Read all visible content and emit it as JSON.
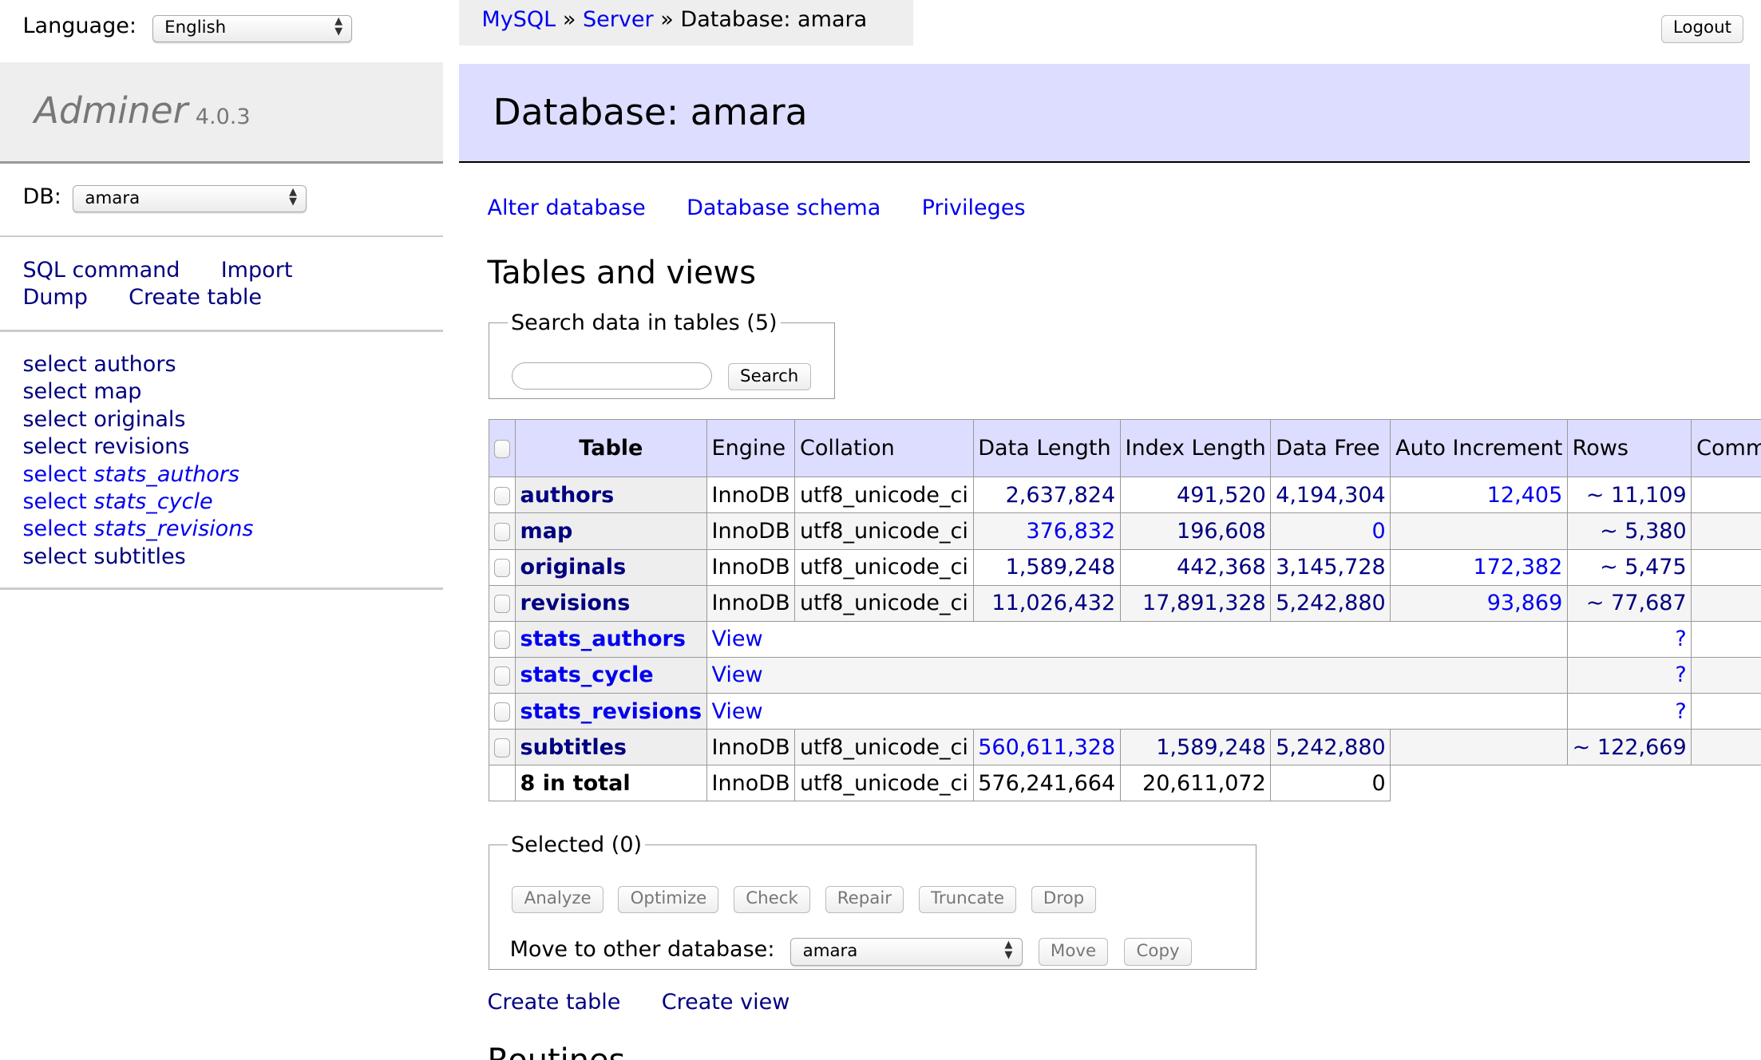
{
  "language": {
    "label": "Language:",
    "value": "English"
  },
  "app": {
    "name": "Adminer",
    "version": "4.0.3"
  },
  "db": {
    "label": "DB:",
    "value": "amara"
  },
  "sidebar": {
    "links": [
      {
        "label": "SQL command"
      },
      {
        "label": "Import"
      },
      {
        "label": "Dump"
      },
      {
        "label": "Create table"
      }
    ],
    "tables": [
      {
        "prefix": "select",
        "name": "authors",
        "view": false
      },
      {
        "prefix": "select",
        "name": "map",
        "view": false
      },
      {
        "prefix": "select",
        "name": "originals",
        "view": false
      },
      {
        "prefix": "select",
        "name": "revisions",
        "view": false
      },
      {
        "prefix": "select",
        "name": "stats_authors",
        "view": true
      },
      {
        "prefix": "select",
        "name": "stats_cycle",
        "view": true
      },
      {
        "prefix": "select",
        "name": "stats_revisions",
        "view": true
      },
      {
        "prefix": "select",
        "name": "subtitles",
        "view": false
      }
    ]
  },
  "breadcrumb": {
    "items": [
      "MySQL",
      "Server"
    ],
    "sep": "»",
    "current": "Database: amara"
  },
  "logout": "Logout",
  "header": {
    "title": "Database: amara"
  },
  "actions": [
    "Alter database",
    "Database schema",
    "Privileges"
  ],
  "section_title": "Tables and views",
  "search": {
    "legend": "Search data in tables (5)",
    "value": "",
    "button": "Search"
  },
  "table": {
    "headers": [
      "Table",
      "Engine",
      "Collation",
      "Data Length",
      "Index Length",
      "Data Free",
      "Auto Increment",
      "Rows",
      "Comment"
    ],
    "rows": [
      {
        "name": "authors",
        "engine": "InnoDB",
        "collation": "utf8_unicode_ci",
        "data_length": "2,637,824",
        "index_length": "491,520",
        "data_free": "4,194,304",
        "auto_increment": "12,405",
        "rows": "~ 11,109",
        "comment": ""
      },
      {
        "name": "map",
        "engine": "InnoDB",
        "collation": "utf8_unicode_ci",
        "data_length": "376,832",
        "index_length": "196,608",
        "data_free": "0",
        "auto_increment": "",
        "rows": "~ 5,380",
        "comment": ""
      },
      {
        "name": "originals",
        "engine": "InnoDB",
        "collation": "utf8_unicode_ci",
        "data_length": "1,589,248",
        "index_length": "442,368",
        "data_free": "3,145,728",
        "auto_increment": "172,382",
        "rows": "~ 5,475",
        "comment": ""
      },
      {
        "name": "revisions",
        "engine": "InnoDB",
        "collation": "utf8_unicode_ci",
        "data_length": "11,026,432",
        "index_length": "17,891,328",
        "data_free": "5,242,880",
        "auto_increment": "93,869",
        "rows": "~ 77,687",
        "comment": ""
      },
      {
        "name": "stats_authors",
        "type": "View",
        "rows": "?"
      },
      {
        "name": "stats_cycle",
        "type": "View",
        "rows": "?"
      },
      {
        "name": "stats_revisions",
        "type": "View",
        "rows": "?"
      },
      {
        "name": "subtitles",
        "engine": "InnoDB",
        "collation": "utf8_unicode_ci",
        "data_length": "560,611,328",
        "index_length": "1,589,248",
        "data_free": "5,242,880",
        "auto_increment": "",
        "rows": "~ 122,669",
        "comment": ""
      }
    ],
    "total": {
      "name": "8 in total",
      "engine": "InnoDB",
      "collation": "utf8_unicode_ci",
      "data_length": "576,241,664",
      "index_length": "20,611,072",
      "data_free": "0"
    }
  },
  "selected": {
    "legend": "Selected (0)",
    "buttons": [
      "Analyze",
      "Optimize",
      "Check",
      "Repair",
      "Truncate",
      "Drop"
    ],
    "move_label": "Move to other database:",
    "move_value": "amara",
    "move": "Move",
    "copy": "Copy"
  },
  "bottom_links": [
    "Create table",
    "Create view"
  ],
  "routines_title": "Routines",
  "colors": {
    "link": "#0000ee",
    "visited": "#000080",
    "header_bg": "#ddddff",
    "sidebar_bg": "#eeeeee"
  }
}
